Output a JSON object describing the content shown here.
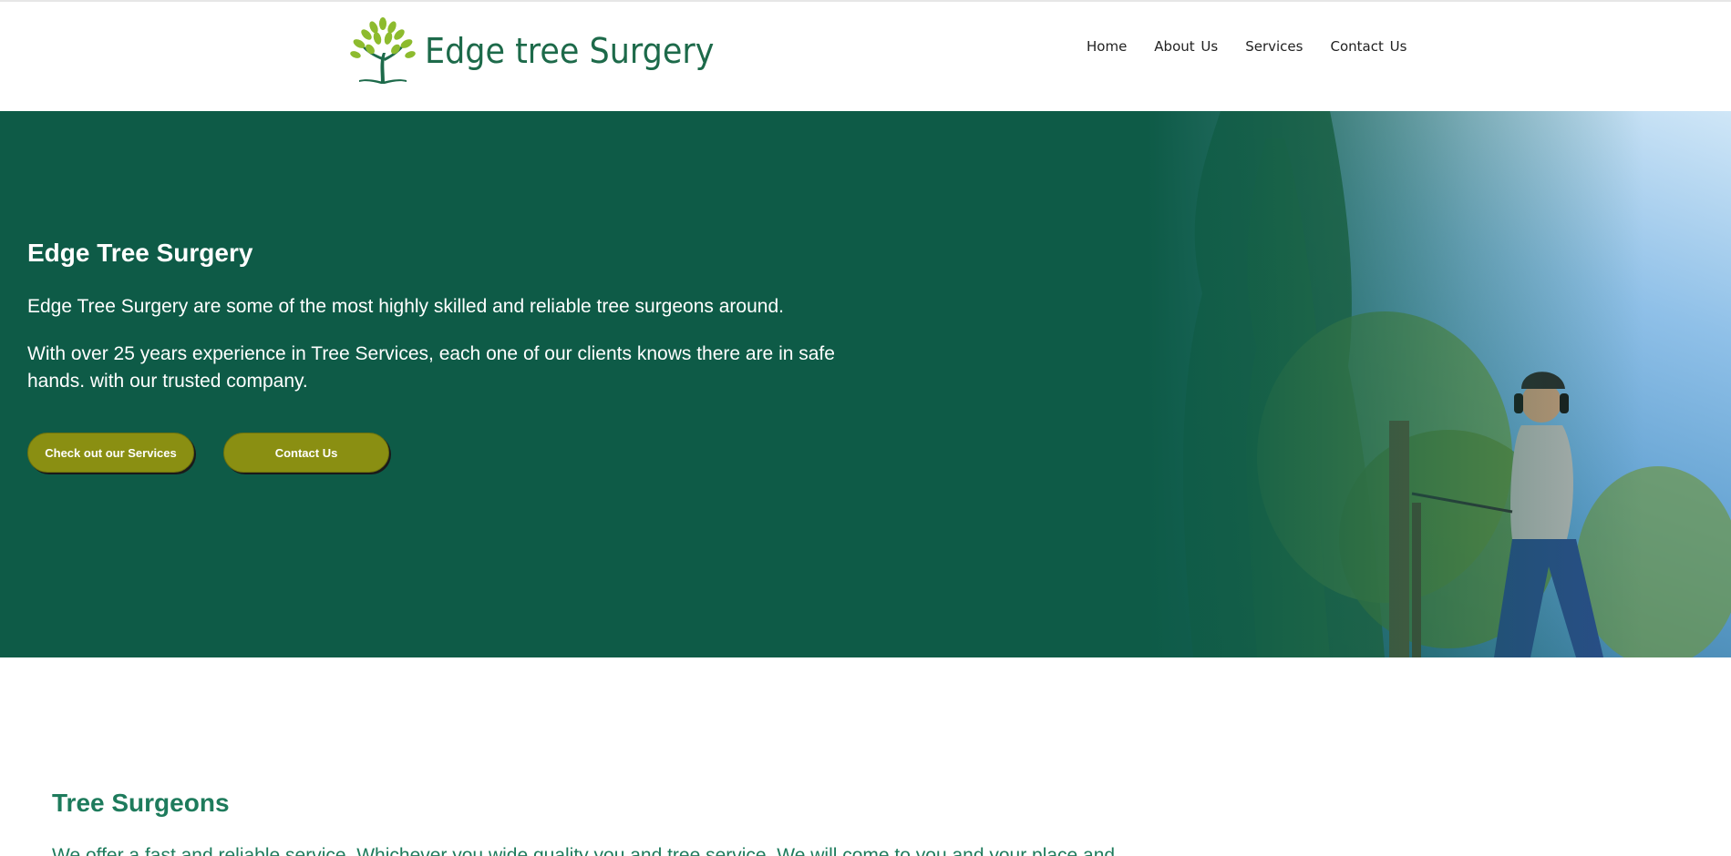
{
  "brand": {
    "name": "Edge tree Surgery",
    "color": "#1d6a4a",
    "leaf_color": "#8dbb2e"
  },
  "nav": {
    "items": [
      {
        "label": "Home"
      },
      {
        "label": "About  Us"
      },
      {
        "label": "Services"
      },
      {
        "label": "Contact  Us"
      }
    ]
  },
  "hero": {
    "title": "Edge Tree Surgery",
    "paragraph1": "Edge Tree Surgery are some of the most highly skilled and reliable tree surgeons around.",
    "paragraph2": "With over 25 years experience in Tree Services, each one of our clients knows there are in safe hands. with our trusted company.",
    "background_color": "#0e5b47",
    "buttons": [
      {
        "label": "Check out our Services"
      },
      {
        "label": "Contact Us"
      }
    ],
    "button_color": "#8a8f12"
  },
  "section": {
    "title": "Tree Surgeons",
    "paragraph": "We offer a fast and reliable service. Whichever you wide quality you and tree service. We will come to you and your place and",
    "color": "#1e7b5c"
  }
}
